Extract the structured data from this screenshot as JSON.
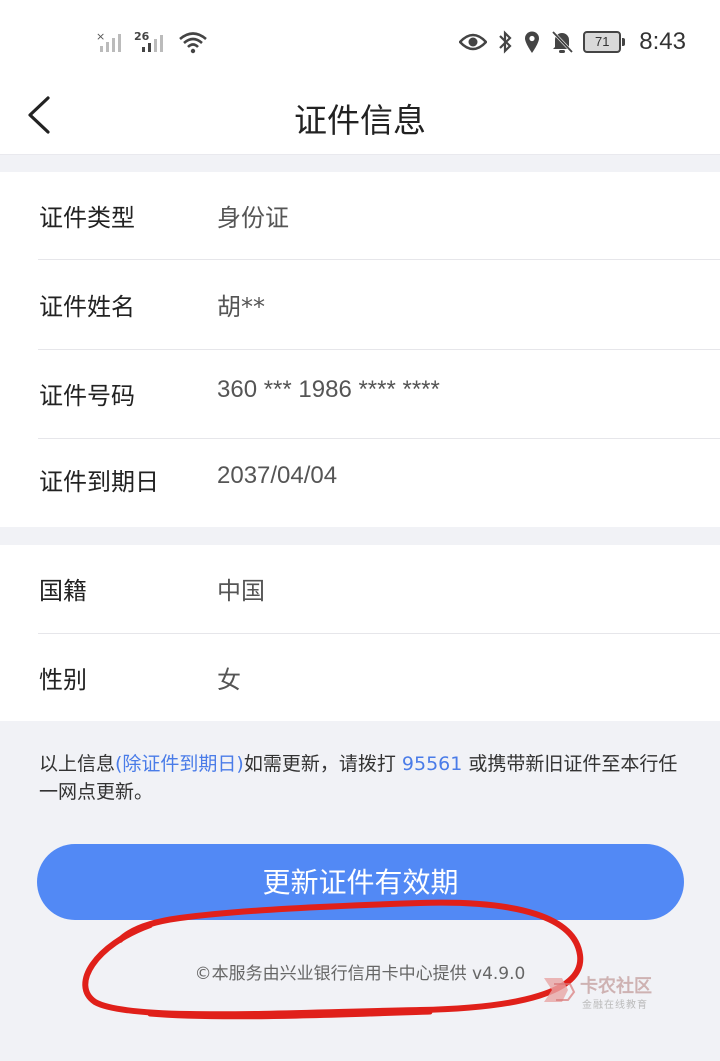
{
  "status_bar": {
    "network_1": "×",
    "network_2": "26",
    "battery": "71",
    "time": "8:43"
  },
  "nav": {
    "title": "证件信息"
  },
  "id_card": {
    "rows": [
      {
        "label": "证件类型",
        "value": "身份证"
      },
      {
        "label": "证件姓名",
        "value": "胡**"
      },
      {
        "label": "证件号码",
        "value": "360 *** 1986 **** ****"
      },
      {
        "label": "证件到期日",
        "value": "2037/04/04"
      }
    ]
  },
  "personal": {
    "rows": [
      {
        "label": "国籍",
        "value": "中国"
      },
      {
        "label": "性别",
        "value": "女"
      }
    ]
  },
  "notice": {
    "part1": "以上信息",
    "highlight1": "(除证件到期日)",
    "part2": "如需更新，请拨打 ",
    "phone": "95561",
    "part3": " 或携带新旧证件至本行任一网点更新。"
  },
  "update_button": {
    "label": "更新证件有效期"
  },
  "footer": {
    "text": "©本服务由兴业银行信用卡中心提供 v4.9.0"
  },
  "watermark": {
    "title": "卡农社区",
    "subtitle": "金融在线教育"
  },
  "colors": {
    "accent": "#5289f5",
    "link": "#4a7ce8",
    "annotation": "#e0201a"
  }
}
